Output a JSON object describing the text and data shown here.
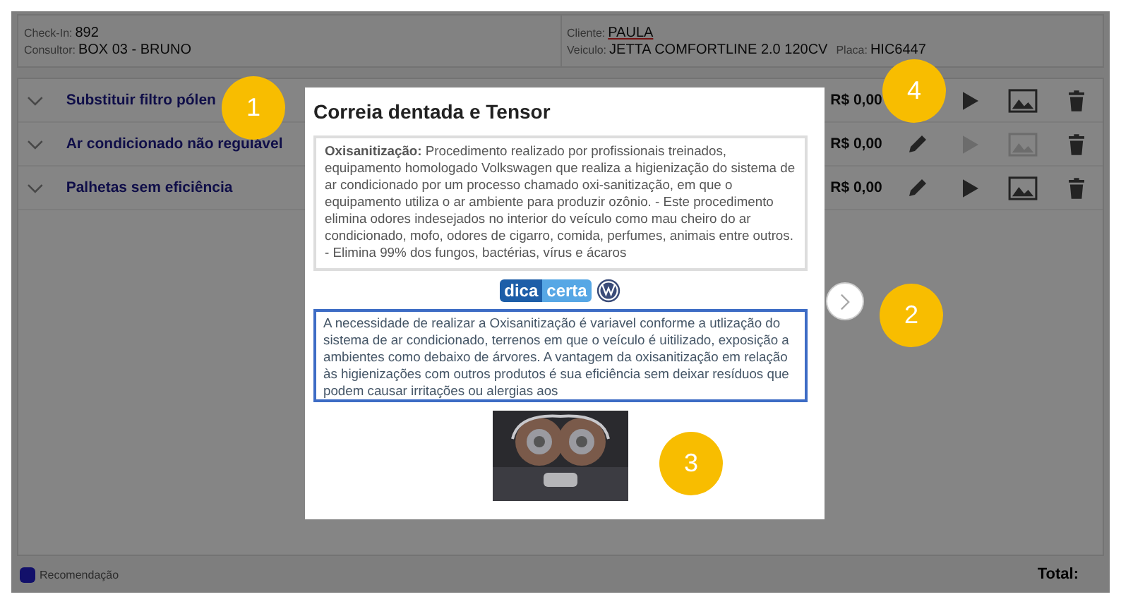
{
  "header": {
    "checkin_label": "Check-In:",
    "checkin": "892",
    "consultor_label": "Consultor:",
    "consultor": "BOX 03 - BRUNO",
    "cliente_label": "Cliente:",
    "cliente": "PAULA",
    "veiculo_label": "Veiculo:",
    "veiculo": "JETTA COMFORTLINE 2.0 120CV",
    "placa_label": "Placa:",
    "placa": "HIC6447"
  },
  "rows": [
    {
      "title": "Substituir filtro pólen",
      "price": "R$ 0,00",
      "editable": false,
      "disabled": false
    },
    {
      "title": "Ar condicionado não regulável",
      "price": "R$ 0,00",
      "editable": true,
      "disabled": true
    },
    {
      "title": "Palhetas sem eficiência",
      "price": "R$ 0,00",
      "editable": true,
      "disabled": false
    }
  ],
  "footer": {
    "legend": [
      {
        "label": "Recomendação",
        "color": "#12106a"
      }
    ],
    "total": "Total:"
  },
  "modal": {
    "title": "Correia dentada e Tensor",
    "description": "**Oxisanitização:** Procedimento realizado por profissionais treinados, equipamento  homologado Volkswagen que realiza a higienização do sistema de ar  condicionado por um processo chamado oxi-sanitização, em que o  equipamento utiliza o ar ambiente para produzir ozônio.  - Este procedimento elimina odores indesejados no interior do veículo como mau cheiro do ar condicionado, mofo, odores de cigarro, comida, perfumes, animais entre outros.  - Elimina 99% dos fungos, bactérias, vírus e ácaros",
    "logo_part1": "dica",
    "logo_part2": "certa",
    "tip": "A necessidade de realizar a Oxisanitização é variavel conforme a utlização do sistema de ar condicionado, terrenos em que o veículo é uitilizado, exposição a ambientes como debaixo de árvores. A vantagem da oxisanitização em relação às higienizações com outros produtos é sua eficiência sem deixar resíduos que podem causar irritações ou alergias aos"
  },
  "badges": [
    "1",
    "2",
    "3",
    "4"
  ]
}
